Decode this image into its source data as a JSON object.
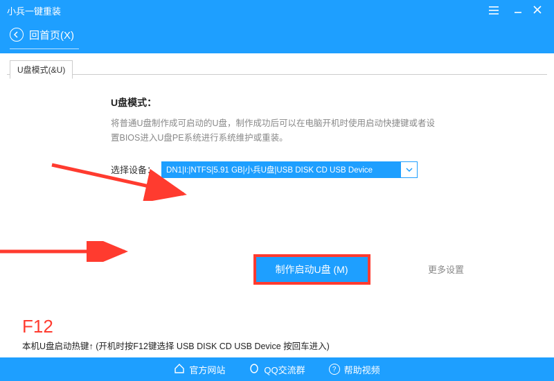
{
  "colors": {
    "primary": "#1E9FFF",
    "accent": "#FF3B2F"
  },
  "titlebar": {
    "title": "小兵一键重装"
  },
  "subheader": {
    "backHome": "回首页(X)"
  },
  "tabs": [
    {
      "label": "U盘模式(&U)"
    }
  ],
  "main": {
    "sectionTitle": "U盘模式：",
    "sectionDesc": "将普通U盘制作成可启动的U盘，制作成功后可以在电脑开机时使用启动快捷键或者设置BIOS进入U盘PE系统进行系统维护或重装。",
    "deviceLabel": "选择设备：",
    "deviceValue": "DN1|I:|NTFS|5.91 GB|小兵U盘|USB DISK CD USB Device",
    "primaryButton": "制作启动U盘 (M)",
    "moreSettings": "更多设置"
  },
  "hotkey": {
    "key": "F12",
    "text": "本机U盘启动热键↑ (开机时按F12键选择 USB DISK CD USB Device 按回车进入)"
  },
  "footer": {
    "items": [
      {
        "label": "官方网站"
      },
      {
        "label": "QQ交流群"
      },
      {
        "label": "帮助视频"
      }
    ]
  }
}
